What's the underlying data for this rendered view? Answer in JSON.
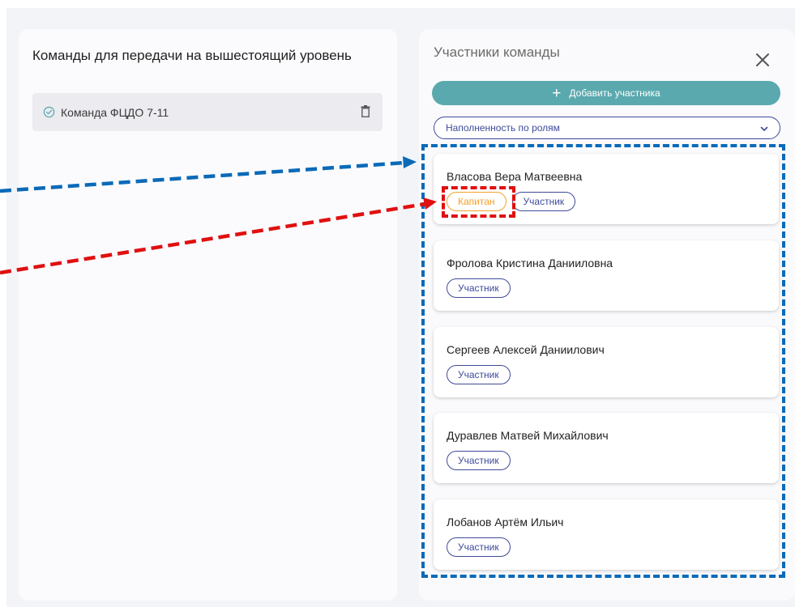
{
  "left_panel": {
    "title": "Команды для передачи на вышестоящий уровень",
    "teams": [
      {
        "name": "Команда ФЦДО 7-11"
      }
    ]
  },
  "right_panel": {
    "title": "Участники команды",
    "add_button_label": "Добавить участника",
    "roles_select_value": "Наполненность по ролям",
    "members": [
      {
        "name": "Власова Вера Матвеевна",
        "roles": [
          "Капитан",
          "Участник"
        ]
      },
      {
        "name": "Фролова Кристина Данииловна",
        "roles": [
          "Участник"
        ]
      },
      {
        "name": "Сергеев Алексей Даниилович",
        "roles": [
          "Участник"
        ]
      },
      {
        "name": "Дуравлев Матвей Михайлович",
        "roles": [
          "Участник"
        ]
      },
      {
        "name": "Лобанов Артём Ильич",
        "roles": [
          "Участник"
        ]
      }
    ]
  },
  "colors": {
    "accent_teal": "#5aa9ae",
    "role_member": "#3f4a9a",
    "role_captain": "#f2a12a",
    "annotation_blue": "#0a6ab8",
    "annotation_red": "#e01010"
  },
  "icons": [
    "check-circle-icon",
    "trash-icon",
    "close-icon",
    "plus-icon",
    "chevron-down-icon"
  ]
}
